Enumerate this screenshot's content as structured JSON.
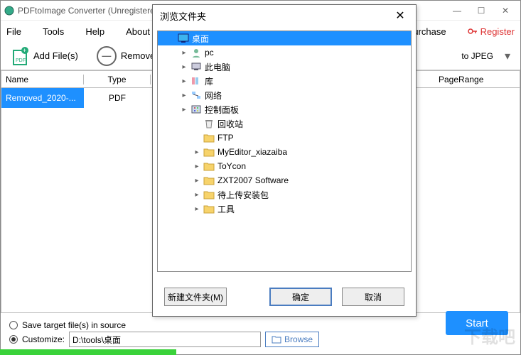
{
  "main": {
    "title": "PDFtoImage Converter (Unregistered)",
    "menu": [
      "File",
      "Tools",
      "Help",
      "About"
    ],
    "purchase": "Purchase",
    "register": "Register",
    "addFiles": "Add File(s)",
    "remove": "Remove",
    "format_label": "to JPEG",
    "columns": {
      "name": "Name",
      "type": "Type",
      "range": "PageRange"
    },
    "row": {
      "name": "Removed_2020-...",
      "type": "PDF"
    },
    "saveSource": "Save target file(s) in source",
    "customize": "Customize:",
    "path": "D:\\tools\\桌面",
    "browse": "Browse",
    "start": "Start"
  },
  "dialog": {
    "title": "浏览文件夹",
    "tree": [
      {
        "label": "桌面",
        "level": 0,
        "root": true,
        "icon": "desktop",
        "arrow": ""
      },
      {
        "label": "pc",
        "level": 1,
        "icon": "user",
        "arrow": "▸"
      },
      {
        "label": "此电脑",
        "level": 1,
        "icon": "pc",
        "arrow": "▸"
      },
      {
        "label": "库",
        "level": 1,
        "icon": "lib",
        "arrow": "▸"
      },
      {
        "label": "网络",
        "level": 1,
        "icon": "net",
        "arrow": "▸"
      },
      {
        "label": "控制面板",
        "level": 1,
        "icon": "ctrl",
        "arrow": "▸"
      },
      {
        "label": "回收站",
        "level": 2,
        "icon": "bin",
        "arrow": ""
      },
      {
        "label": "FTP",
        "level": 2,
        "icon": "folder",
        "arrow": ""
      },
      {
        "label": "MyEditor_xiazaiba",
        "level": 2,
        "icon": "folder",
        "arrow": "▸"
      },
      {
        "label": "ToYcon",
        "level": 2,
        "icon": "folder",
        "arrow": "▸"
      },
      {
        "label": "ZXT2007 Software",
        "level": 2,
        "icon": "folder",
        "arrow": "▸"
      },
      {
        "label": "待上传安装包",
        "level": 2,
        "icon": "folder",
        "arrow": "▸"
      },
      {
        "label": "工具",
        "level": 2,
        "icon": "folder",
        "arrow": "▸"
      }
    ],
    "newFolder": "新建文件夹(M)",
    "ok": "确定",
    "cancel": "取消"
  },
  "watermark": "下载吧"
}
